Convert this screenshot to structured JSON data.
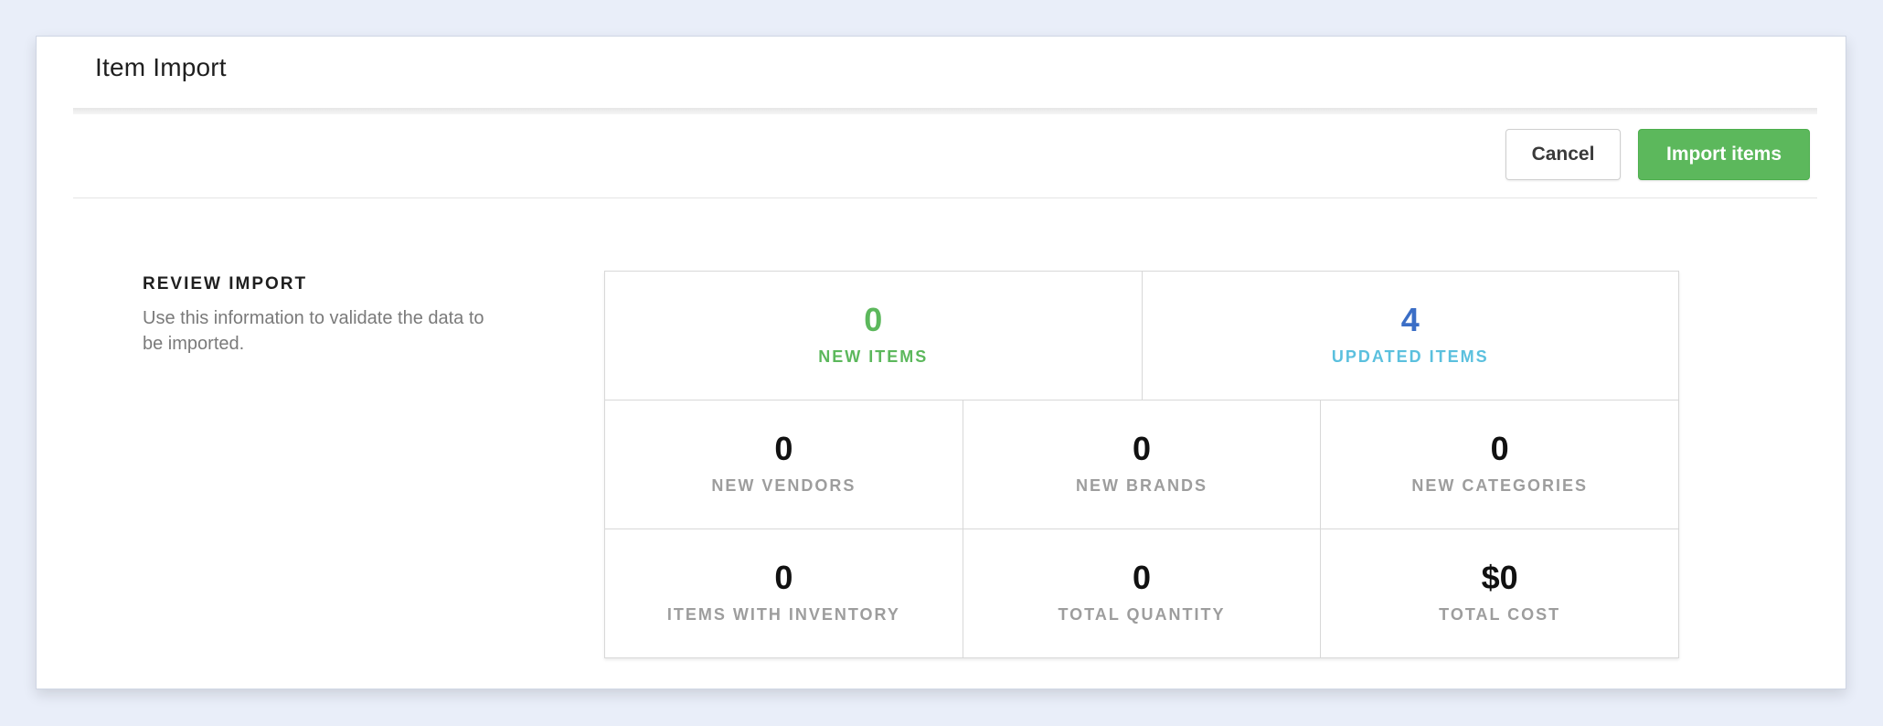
{
  "header": {
    "title": "Item Import"
  },
  "toolbar": {
    "cancel_label": "Cancel",
    "import_label": "Import items"
  },
  "review": {
    "heading": "REVIEW IMPORT",
    "description": "Use this information to validate the data to be imported."
  },
  "stats": {
    "new_items": {
      "value": "0",
      "label": "NEW ITEMS"
    },
    "updated_items": {
      "value": "4",
      "label": "UPDATED ITEMS"
    },
    "new_vendors": {
      "value": "0",
      "label": "NEW VENDORS"
    },
    "new_brands": {
      "value": "0",
      "label": "NEW BRANDS"
    },
    "new_categories": {
      "value": "0",
      "label": "NEW CATEGORIES"
    },
    "items_with_inventory": {
      "value": "0",
      "label": "ITEMS WITH INVENTORY"
    },
    "total_quantity": {
      "value": "0",
      "label": "TOTAL QUANTITY"
    },
    "total_cost": {
      "value": "$0",
      "label": "TOTAL COST"
    }
  },
  "colors": {
    "primary_green": "#5cb85c",
    "updated_value_blue": "#3b6ec6",
    "updated_label_blue": "#5bc0de",
    "background": "#e9eef9"
  }
}
